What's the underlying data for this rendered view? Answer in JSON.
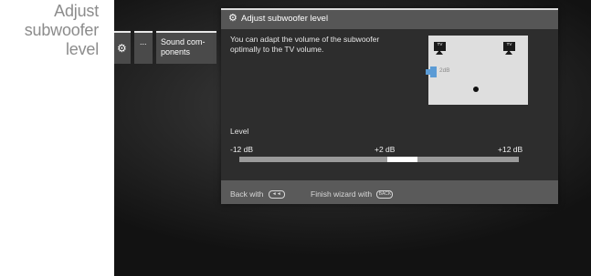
{
  "caption": {
    "line1": "Adjust",
    "line2": "subwoofer",
    "line3": "level"
  },
  "menu": {
    "settings_icon": "gear-icon",
    "more_label": "...",
    "sound_label_1": "Sound com-",
    "sound_label_2": "ponents"
  },
  "dialog": {
    "title_icon": "gears-icon",
    "title": "Adjust subwoofer level",
    "description_1": "You can adapt the volume of the subwoofer",
    "description_2": "optimally to the TV volume.",
    "diagram": {
      "tv_left": "TV",
      "tv_right": "TV",
      "subwoofer_value": "2dB",
      "subwoofer_color": "#5b9bd5"
    },
    "level_label": "Level",
    "min_label": "-12 dB",
    "current_label": "+2 dB",
    "max_label": "+12 dB",
    "slider": {
      "min": -12,
      "max": 12,
      "value": 2
    },
    "back_hint": "Back with",
    "back_button": "◄◄",
    "finish_hint": "Finish wizard with",
    "finish_button": "BACK"
  }
}
